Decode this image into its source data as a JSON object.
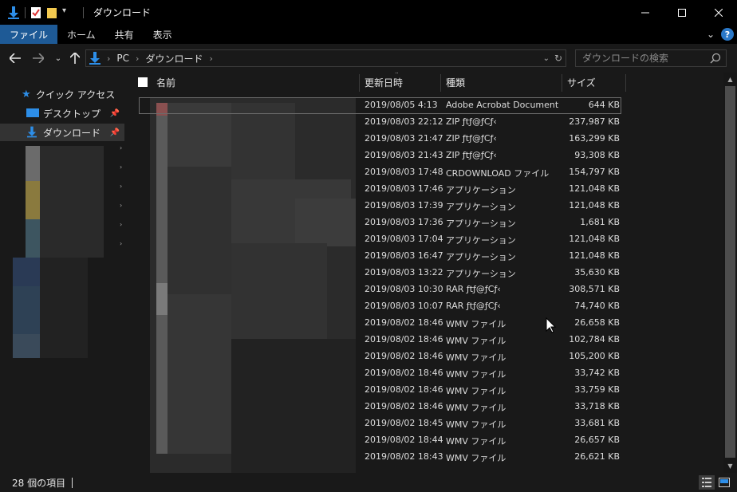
{
  "title": "ダウンロード",
  "ribbon": {
    "tabs": [
      "ファイル",
      "ホーム",
      "共有",
      "表示"
    ],
    "help": "?"
  },
  "address": {
    "crumbs": [
      "PC",
      "ダウンロード"
    ]
  },
  "search": {
    "placeholder": "ダウンロードの検索"
  },
  "nav": {
    "quick_access": "クイック アクセス",
    "desktop": "デスクトップ",
    "downloads": "ダウンロード"
  },
  "columns": {
    "name": "名前",
    "date": "更新日時",
    "type": "種類",
    "size": "サイズ"
  },
  "files": [
    {
      "date": "2019/08/05 4:13",
      "type": "Adobe Acrobat Document",
      "size": "644 KB"
    },
    {
      "date": "2019/08/03 22:12",
      "type": "ZIP ƒtƒ@ƒCƒ‹",
      "size": "237,987 KB"
    },
    {
      "date": "2019/08/03 21:47",
      "type": "ZIP ƒtƒ@ƒCƒ‹",
      "size": "163,299 KB"
    },
    {
      "date": "2019/08/03 21:43",
      "type": "ZIP ƒtƒ@ƒCƒ‹",
      "size": "93,308 KB"
    },
    {
      "date": "2019/08/03 17:48",
      "type": "CRDOWNLOAD ファイル",
      "size": "154,797 KB"
    },
    {
      "date": "2019/08/03 17:46",
      "type": "アプリケーション",
      "size": "121,048 KB"
    },
    {
      "date": "2019/08/03 17:39",
      "type": "アプリケーション",
      "size": "121,048 KB"
    },
    {
      "date": "2019/08/03 17:36",
      "type": "アプリケーション",
      "size": "1,681 KB"
    },
    {
      "date": "2019/08/03 17:04",
      "type": "アプリケーション",
      "size": "121,048 KB"
    },
    {
      "date": "2019/08/03 16:47",
      "type": "アプリケーション",
      "size": "121,048 KB"
    },
    {
      "date": "2019/08/03 13:22",
      "type": "アプリケーション",
      "size": "35,630 KB"
    },
    {
      "date": "2019/08/03 10:30",
      "type": "RAR ƒtƒ@ƒCƒ‹",
      "size": "308,571 KB"
    },
    {
      "date": "2019/08/03 10:07",
      "type": "RAR ƒtƒ@ƒCƒ‹",
      "size": "74,740 KB"
    },
    {
      "date": "2019/08/02 18:46",
      "type": "WMV ファイル",
      "size": "26,658 KB"
    },
    {
      "date": "2019/08/02 18:46",
      "type": "WMV ファイル",
      "size": "102,784 KB"
    },
    {
      "date": "2019/08/02 18:46",
      "type": "WMV ファイル",
      "size": "105,200 KB"
    },
    {
      "date": "2019/08/02 18:46",
      "type": "WMV ファイル",
      "size": "33,742 KB"
    },
    {
      "date": "2019/08/02 18:46",
      "type": "WMV ファイル",
      "size": "33,759 KB"
    },
    {
      "date": "2019/08/02 18:46",
      "type": "WMV ファイル",
      "size": "33,718 KB"
    },
    {
      "date": "2019/08/02 18:45",
      "type": "WMV ファイル",
      "size": "33,681 KB"
    },
    {
      "date": "2019/08/02 18:44",
      "type": "WMV ファイル",
      "size": "26,657 KB"
    },
    {
      "date": "2019/08/02 18:43",
      "type": "WMV ファイル",
      "size": "26,621 KB"
    }
  ],
  "status": {
    "count_text": "28 個の項目"
  },
  "colors": {
    "accent": "#1e5a96",
    "background": "#191919",
    "titlebar": "#000000",
    "download_blue": "#2d8ee8"
  },
  "icons": {
    "download": "download-arrow-icon",
    "properties": "properties-icon",
    "new_folder": "new-folder-icon",
    "pin": "pin-icon"
  }
}
